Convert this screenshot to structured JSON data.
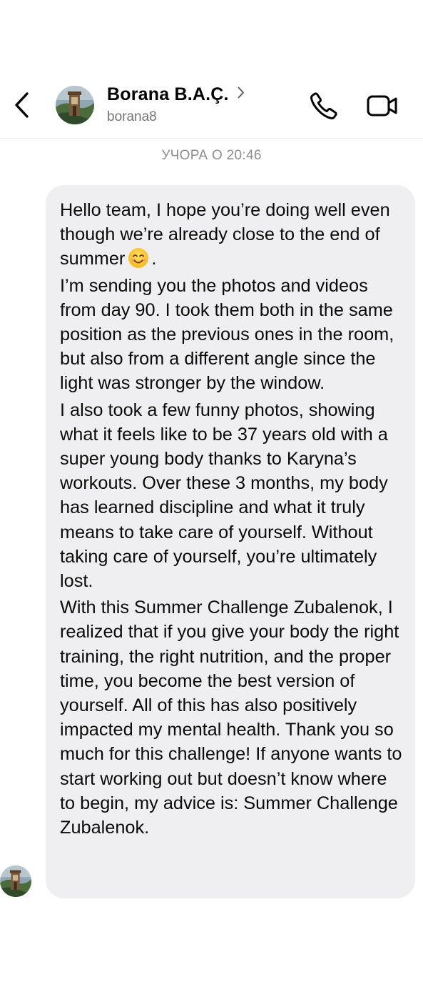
{
  "header": {
    "contact_name": "Borana B.A.Ç.",
    "username": "borana8"
  },
  "chat": {
    "timestamp": "УЧОРА О 20:46",
    "message": {
      "paragraphs": [
        {
          "before_emoji": "Hello team, I hope you’re doing well even though we’re already close to the end of summer",
          "emoji": "smiling-face-emoji",
          "after_emoji": "."
        },
        {
          "text": "I’m sending you the photos and videos from day 90. I took them both in the same position as the previous ones in the room, but also from a different angle since the light was stronger by the window."
        },
        {
          "text": "I also took a few funny photos, showing what it feels like to be 37 years old with a super young body thanks to Karyna’s workouts. Over these 3 months, my body has learned discipline and what it truly means to take care of yourself. Without taking care of yourself, you’re ultimately lost."
        },
        {
          "text": "With this Summer Challenge Zubalenok, I realized that if you give your body the right training, the right nutrition, and the proper time, you become the best version of yourself. All of this has also positively impacted my mental health. Thank you so much for this challenge! If anyone wants to start working out but doesn’t know where to begin, my advice is: Summer Challenge Zubalenok."
        }
      ]
    }
  },
  "icons": {
    "back": "chevron-left-icon",
    "profile_chevron": "chevron-right-icon",
    "call": "phone-icon",
    "video": "video-camera-icon"
  },
  "colors": {
    "bubble_bg": "#efeff1",
    "secondary_text": "#8e8e8e",
    "username_text": "#737373"
  }
}
